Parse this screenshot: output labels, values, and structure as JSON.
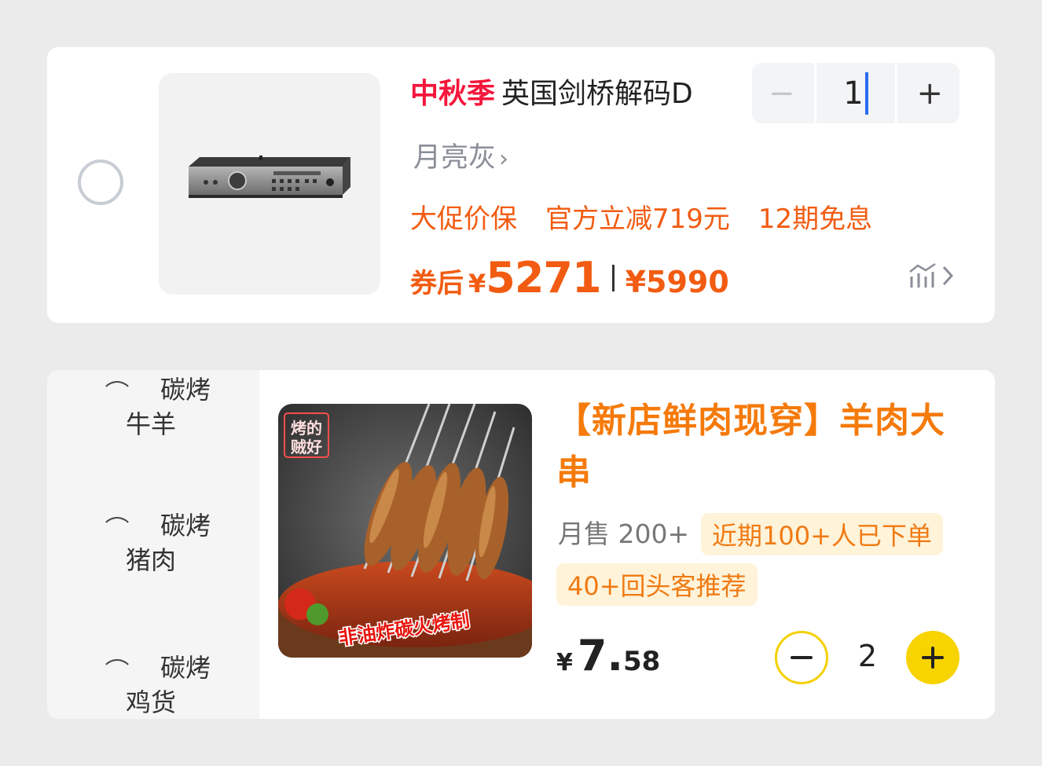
{
  "cart_item": {
    "promo_tag": "中秋季",
    "title": "英国剑桥解码D",
    "quantity": "1",
    "minus_symbol": "−",
    "plus_symbol": "+",
    "spec": "月亮灰",
    "promotions": [
      "大促价保",
      "官方立减719元",
      "12期免息"
    ],
    "price_label": "券后",
    "currency": "¥",
    "coupon_price": "5271",
    "original_price": "¥5990",
    "accent_color": "#f25c12"
  },
  "menu": {
    "categories": [
      {
        "line1": "碳烤",
        "line2": "牛羊"
      },
      {
        "line1": "碳烤",
        "line2": "猪肉"
      },
      {
        "line1": "碳烤",
        "line2": "鸡货"
      }
    ],
    "item": {
      "title": "【新店鲜肉现穿】羊肉大串",
      "sales": "月售 200+",
      "badges": [
        "近期100+人已下单",
        "40+回头客推荐"
      ],
      "image_sticker_top": "烤的好 贼",
      "image_sticker_bottom": "非油炸碳火烤制",
      "currency": "¥",
      "price_int": "7.",
      "price_dec": "58",
      "quantity": "2",
      "accent_color": "#f7d300"
    }
  }
}
